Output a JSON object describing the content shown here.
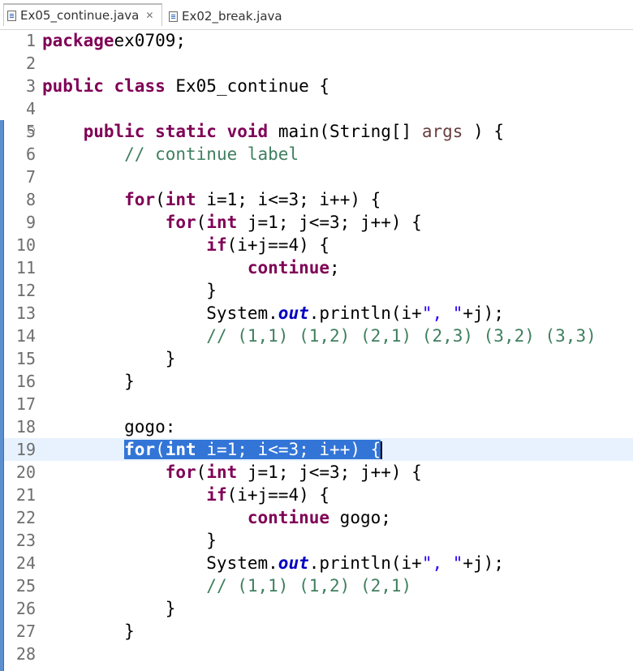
{
  "tabs": [
    {
      "label": "Ex05_continue.java",
      "active": true,
      "close_glyph": "✕"
    },
    {
      "label": "Ex02_break.java",
      "active": false
    }
  ],
  "editor": {
    "selected_line": 19,
    "lines": [
      {
        "n": "1",
        "tokens": [
          [
            "kw",
            "package"
          ],
          [
            "",
            "ex0709;"
          ]
        ]
      },
      {
        "n": "2",
        "tokens": []
      },
      {
        "n": "3",
        "tokens": [
          [
            "kw",
            "public"
          ],
          [
            "",
            " "
          ],
          [
            "kw",
            "class"
          ],
          [
            "",
            " Ex05_continue {"
          ]
        ]
      },
      {
        "n": "4",
        "tokens": []
      },
      {
        "n": "5",
        "fold": true,
        "tokens": [
          [
            "",
            "    "
          ],
          [
            "kw",
            "public"
          ],
          [
            "",
            " "
          ],
          [
            "kw",
            "static"
          ],
          [
            "",
            " "
          ],
          [
            "kw",
            "void"
          ],
          [
            "",
            " main(String[] "
          ],
          [
            "param",
            "args"
          ],
          [
            "",
            " ) {"
          ]
        ]
      },
      {
        "n": "6",
        "tokens": [
          [
            "",
            "        "
          ],
          [
            "cm",
            "// continue label"
          ]
        ]
      },
      {
        "n": "7",
        "tokens": []
      },
      {
        "n": "8",
        "tokens": [
          [
            "",
            "        "
          ],
          [
            "kw",
            "for"
          ],
          [
            "",
            "("
          ],
          [
            "kw",
            "int"
          ],
          [
            "",
            " i=1; i<=3; i++) {"
          ]
        ]
      },
      {
        "n": "9",
        "tokens": [
          [
            "",
            "            "
          ],
          [
            "kw",
            "for"
          ],
          [
            "",
            "("
          ],
          [
            "kw",
            "int"
          ],
          [
            "",
            " j=1; j<=3; j++) {"
          ]
        ]
      },
      {
        "n": "10",
        "tokens": [
          [
            "",
            "                "
          ],
          [
            "kw",
            "if"
          ],
          [
            "",
            "(i+j==4) {"
          ]
        ]
      },
      {
        "n": "11",
        "tokens": [
          [
            "",
            "                    "
          ],
          [
            "kw",
            "continue"
          ],
          [
            "",
            ";"
          ]
        ]
      },
      {
        "n": "12",
        "tokens": [
          [
            "",
            "                }"
          ]
        ]
      },
      {
        "n": "13",
        "tokens": [
          [
            "",
            "                System."
          ],
          [
            "fld",
            "out"
          ],
          [
            "",
            ".println(i+"
          ],
          [
            "st",
            "\", \""
          ],
          [
            "",
            "+j);"
          ]
        ]
      },
      {
        "n": "14",
        "tokens": [
          [
            "",
            "                "
          ],
          [
            "cm",
            "// (1,1) (1,2) (2,1) (2,3) (3,2) (3,3)"
          ]
        ]
      },
      {
        "n": "15",
        "tokens": [
          [
            "",
            "            }"
          ]
        ]
      },
      {
        "n": "16",
        "tokens": [
          [
            "",
            "        }"
          ]
        ]
      },
      {
        "n": "17",
        "tokens": []
      },
      {
        "n": "18",
        "tokens": [
          [
            "",
            "        gogo:"
          ]
        ]
      },
      {
        "n": "19",
        "tokens": [
          [
            "",
            "        "
          ],
          [
            "sel-kw",
            "for"
          ],
          [
            "sel",
            "("
          ],
          [
            "sel-kw",
            "int"
          ],
          [
            "sel",
            " i=1; i<=3; i++) {"
          ]
        ]
      },
      {
        "n": "20",
        "tokens": [
          [
            "",
            "            "
          ],
          [
            "kw",
            "for"
          ],
          [
            "",
            "("
          ],
          [
            "kw",
            "int"
          ],
          [
            "",
            " j=1; j<=3; j++) {"
          ]
        ]
      },
      {
        "n": "21",
        "tokens": [
          [
            "",
            "                "
          ],
          [
            "kw",
            "if"
          ],
          [
            "",
            "(i+j==4) {"
          ]
        ]
      },
      {
        "n": "22",
        "tokens": [
          [
            "",
            "                    "
          ],
          [
            "kw",
            "continue"
          ],
          [
            "",
            " gogo;"
          ]
        ]
      },
      {
        "n": "23",
        "tokens": [
          [
            "",
            "                }"
          ]
        ]
      },
      {
        "n": "24",
        "tokens": [
          [
            "",
            "                System."
          ],
          [
            "fld",
            "out"
          ],
          [
            "",
            ".println(i+"
          ],
          [
            "st",
            "\", \""
          ],
          [
            "",
            "+j);"
          ]
        ]
      },
      {
        "n": "25",
        "tokens": [
          [
            "",
            "                "
          ],
          [
            "cm",
            "// (1,1) (1,2) (2,1)"
          ]
        ]
      },
      {
        "n": "26",
        "tokens": [
          [
            "",
            "            }"
          ]
        ]
      },
      {
        "n": "27",
        "tokens": [
          [
            "",
            "        }"
          ]
        ]
      },
      {
        "n": "28",
        "tokens": []
      }
    ]
  }
}
